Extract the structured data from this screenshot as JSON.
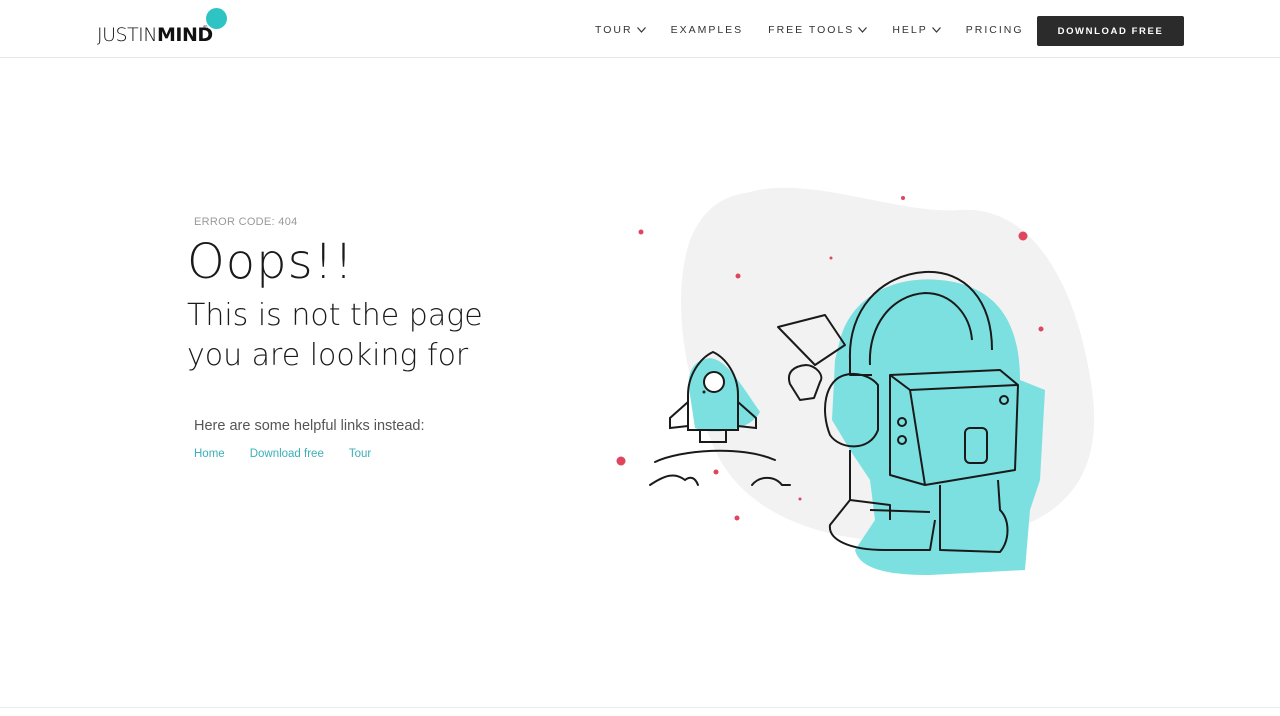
{
  "brand": {
    "logo_light": "JUSTIN",
    "logo_bold": "MIND",
    "registered": "®"
  },
  "nav": {
    "items": [
      {
        "label": "TOUR",
        "dropdown": true
      },
      {
        "label": "EXAMPLES",
        "dropdown": false
      },
      {
        "label": "FREE TOOLS",
        "dropdown": true
      },
      {
        "label": "HELP",
        "dropdown": true
      },
      {
        "label": "PRICING",
        "dropdown": false
      }
    ],
    "cta_label": "DOWNLOAD FREE"
  },
  "error": {
    "code_label": "ERROR CODE: 404",
    "headline": "Oops!!",
    "subtitle_line1": "This is not the page",
    "subtitle_line2": "you are looking for"
  },
  "helpful": {
    "text": "Here are some helpful links instead:",
    "links": [
      {
        "label": "Home"
      },
      {
        "label": "Download free"
      },
      {
        "label": "Tour"
      }
    ]
  },
  "colors": {
    "accent": "#2ec4c4",
    "astronaut_fill": "#7de0e0",
    "blob": "#f2f2f2",
    "dots": "#e0455e",
    "button_bg": "#2b2b2b",
    "link": "#3ab0b8"
  }
}
